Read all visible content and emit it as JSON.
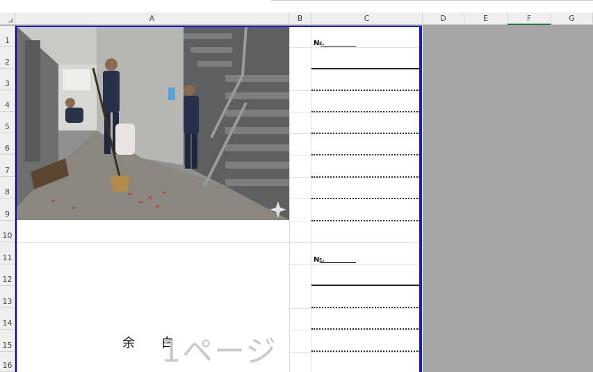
{
  "columns": [
    {
      "label": "A",
      "active": false
    },
    {
      "label": "B",
      "active": false
    },
    {
      "label": "C",
      "active": false
    },
    {
      "label": "D",
      "active": false
    },
    {
      "label": "E",
      "active": false
    },
    {
      "label": "F",
      "active": true
    },
    {
      "label": "G",
      "active": false
    }
  ],
  "rows": [
    "1",
    "2",
    "3",
    "4",
    "5",
    "6",
    "7",
    "8",
    "9",
    "10",
    "11",
    "12",
    "13",
    "14",
    "15",
    "16"
  ],
  "cells": {
    "no_label_1": "№.",
    "no_label_2": "№.",
    "blank_text": "余白",
    "page_watermark": "1ページ"
  },
  "photo": {
    "description_icon": "cleaning-staff-photo"
  },
  "colors": {
    "page_border": "#1a1acc",
    "outside_area": "#a6a6a6",
    "active_column": "#217346"
  }
}
